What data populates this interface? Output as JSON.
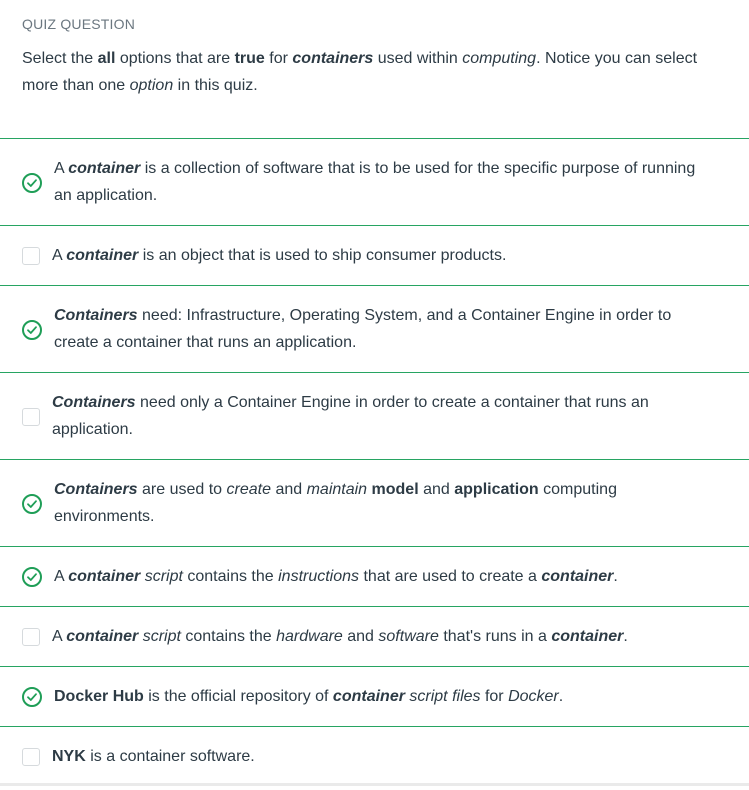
{
  "quiz": {
    "label": "QUIZ QUESTION",
    "question": {
      "p1": "Select the ",
      "b1": "all",
      "p2": " options that are ",
      "b2": "true",
      "p3": " for ",
      "bi1": "containers",
      "p4": " used within ",
      "i1": "computing",
      "p5": ". Notice you can select more than one ",
      "i2": "option",
      "p6": " in this quiz."
    },
    "accent_color": "#27a462",
    "answers": [
      {
        "checked": true,
        "parts": {
          "a": "A ",
          "bi": "container",
          "b": " is a collection of software that is to be used for the specific purpose of running an application."
        }
      },
      {
        "checked": false,
        "parts": {
          "a": "A ",
          "bi": "container",
          "b": " is an object that is used to ship consumer products."
        }
      },
      {
        "checked": true,
        "parts": {
          "bi": "Containers",
          "b": " need: Infrastructure, Operating System, and a Container Engine in order to create a container that runs an application."
        }
      },
      {
        "checked": false,
        "parts": {
          "bi": "Containers",
          "b": " need only a Container Engine in order to create a container that runs an application."
        }
      },
      {
        "checked": true,
        "parts": {
          "bi": "Containers",
          "b": " are used to ",
          "i1": "create",
          "c": " and ",
          "i2": "maintain",
          "d": " ",
          "b1": "model",
          "e": " and ",
          "b2": "application",
          "f": " computing environments."
        }
      },
      {
        "checked": true,
        "parts": {
          "a": "A ",
          "bi": "container",
          "b": " ",
          "i1": "script",
          "c": " contains the ",
          "i2": "instructions",
          "d": " that are used to create a ",
          "bi2": "container",
          "e": "."
        }
      },
      {
        "checked": false,
        "parts": {
          "a": "A ",
          "bi": "container",
          "b": " ",
          "i1": "script",
          "c": " contains the ",
          "i2": "hardware",
          "d": " and ",
          "i3": "software",
          "e": " that's runs in a ",
          "bi2": "container",
          "f": "."
        }
      },
      {
        "checked": true,
        "parts": {
          "b1": "Docker Hub",
          "a": " is the official repository of ",
          "bi": "container",
          "b": " ",
          "i1": "script files",
          "c": " for ",
          "i2": "Docker",
          "d": "."
        }
      },
      {
        "checked": false,
        "parts": {
          "b1": "NYK",
          "a": " is a container software."
        }
      }
    ]
  }
}
